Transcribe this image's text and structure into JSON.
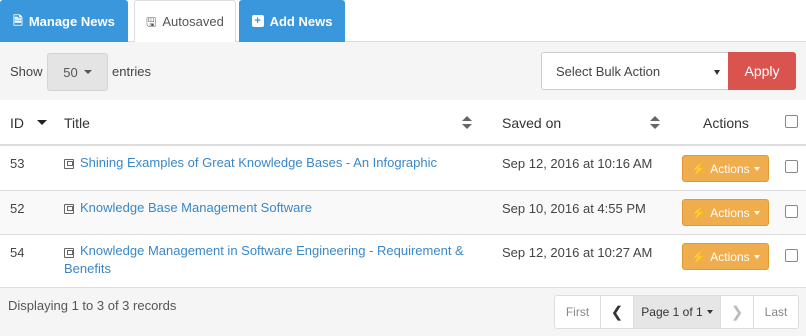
{
  "tabs": [
    {
      "label": "Manage News",
      "icon": "document-icon"
    },
    {
      "label": "Autosaved",
      "icon": "save-icon"
    },
    {
      "label": "Add News",
      "icon": "plus-square-icon"
    }
  ],
  "toolbar": {
    "show_label": "Show",
    "entries_value": "50",
    "entries_label": "entries",
    "bulk_action_value": "Select Bulk Action",
    "apply_label": "Apply"
  },
  "table": {
    "columns": [
      "ID",
      "Title",
      "Saved on",
      "Actions"
    ],
    "rows": [
      {
        "id": "53",
        "title": "Shining Examples of Great Knowledge Bases - An Infographic",
        "saved_on": "Sep 12, 2016 at 10:16 AM",
        "actions_label": "Actions"
      },
      {
        "id": "52",
        "title": "Knowledge Base Management Software",
        "saved_on": "Sep 10, 2016 at 4:55 PM",
        "actions_label": "Actions"
      },
      {
        "id": "54",
        "title": "Knowledge Management in Software Engineering - Requirement & Benefits",
        "saved_on": "Sep 12, 2016 at 10:27 AM",
        "actions_label": "Actions"
      }
    ]
  },
  "footer": {
    "records_text": "Displaying 1 to 3 of 3 records",
    "pager": {
      "first": "First",
      "prev": "❮",
      "page": "Page 1 of 1",
      "next": "❯",
      "last": "Last"
    }
  },
  "colors": {
    "tab_blue": "#3a97dc",
    "apply_red": "#d9534f",
    "actions_orange": "#f0ad4e",
    "link_blue": "#3a87c8"
  }
}
